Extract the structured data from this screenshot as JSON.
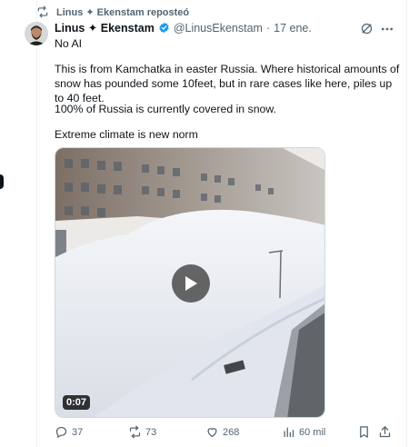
{
  "repost": {
    "text": "Linus ✦ Ekenstam reposteó"
  },
  "tweet": {
    "author_name": "Linus ✦ Ekenstam",
    "handle": "@LinusEkenstam",
    "separator": "·",
    "date": "17 ene.",
    "paragraphs": [
      "No AI",
      "This is from Kamchatka in easter Russia. Where historical amounts of snow has pounded some 10feet, but in rare cases like here, piles up to 40 feet.",
      "100% of Russia is currently covered in snow.",
      "Extreme climate is new norm"
    ],
    "video_duration": "0:07"
  },
  "actions": {
    "replies": "37",
    "reposts": "73",
    "likes": "268",
    "views": "60 mil"
  },
  "colors": {
    "text": "#0f1419",
    "secondary": "#536471",
    "verified": "#1d9bf0"
  },
  "icons": [
    "repost-icon",
    "avatar",
    "verified-badge-icon",
    "grok-icon",
    "more-icon",
    "play-icon",
    "reply-icon",
    "like-icon",
    "views-icon",
    "bookmark-icon",
    "share-icon"
  ]
}
